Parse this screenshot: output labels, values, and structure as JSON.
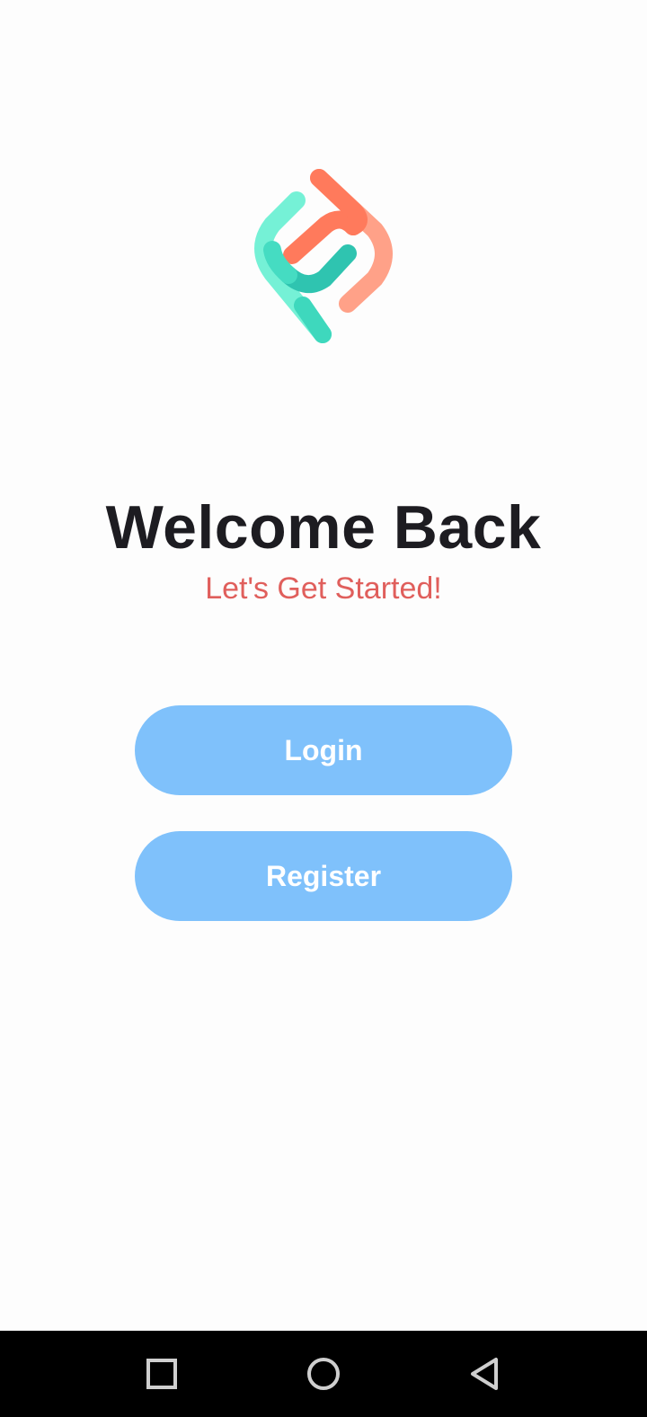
{
  "welcome": {
    "title": "Welcome Back",
    "subtitle": "Let's Get Started!"
  },
  "actions": {
    "login_label": "Login",
    "register_label": "Register"
  },
  "logo": {
    "icon": "app-logo-icon",
    "colors": [
      "#6ef0d4",
      "#ff7a5c",
      "#2fc4b0",
      "#ff9c82"
    ]
  },
  "colors": {
    "title": "#1d1c21",
    "subtitle": "#e05f5c",
    "button_bg": "#7fc1fb",
    "button_text": "#ffffff",
    "background": "#fdfdfd",
    "navbar": "#000000"
  },
  "navigation_bar": {
    "icons": [
      "recents-square-icon",
      "home-circle-icon",
      "back-triangle-icon"
    ]
  }
}
